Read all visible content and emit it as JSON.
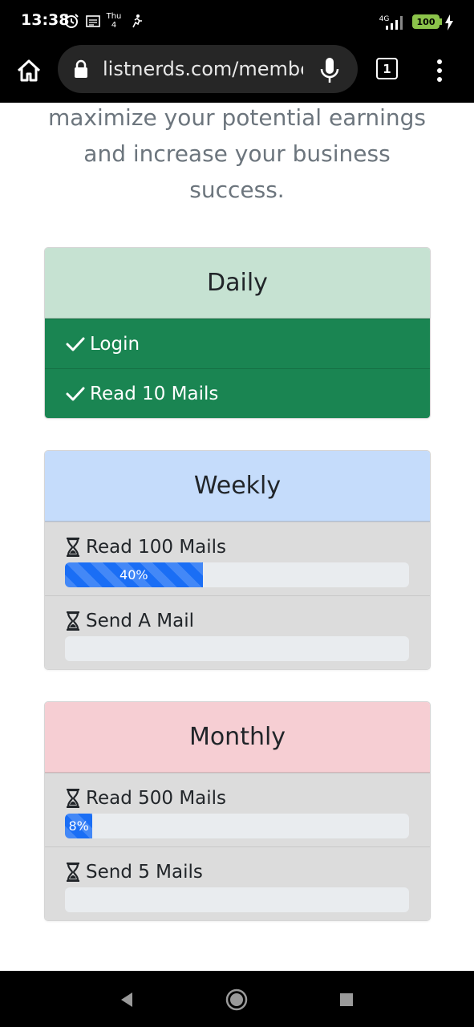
{
  "status_bar": {
    "time": "13:38",
    "date_label": "Thu\n4",
    "network": "4G",
    "battery": "100"
  },
  "browser": {
    "url": "listnerds.com/members",
    "tab_count": "1"
  },
  "intro": {
    "text": "maximize your potential earnings and increase your business success."
  },
  "sections": {
    "daily": {
      "title": "Daily",
      "items": [
        {
          "label": "Login"
        },
        {
          "label": "Read 10 Mails"
        }
      ]
    },
    "weekly": {
      "title": "Weekly",
      "items": [
        {
          "label": "Read 100 Mails",
          "progress": 40,
          "progress_text": "40%"
        },
        {
          "label": "Send A Mail",
          "progress": 0,
          "progress_text": ""
        }
      ]
    },
    "monthly": {
      "title": "Monthly",
      "items": [
        {
          "label": "Read 500 Mails",
          "progress": 8,
          "progress_text": "8%"
        },
        {
          "label": "Send 5 Mails",
          "progress": 0,
          "progress_text": ""
        }
      ]
    }
  },
  "colors": {
    "daily_header": "#c6e2d2",
    "daily_done": "#1a8552",
    "weekly_header": "#c5dcfb",
    "monthly_header": "#f6ced3",
    "progress_fill": "#1a6ef5"
  },
  "icons": {
    "done": "check-icon",
    "pending": "hourglass-icon"
  }
}
